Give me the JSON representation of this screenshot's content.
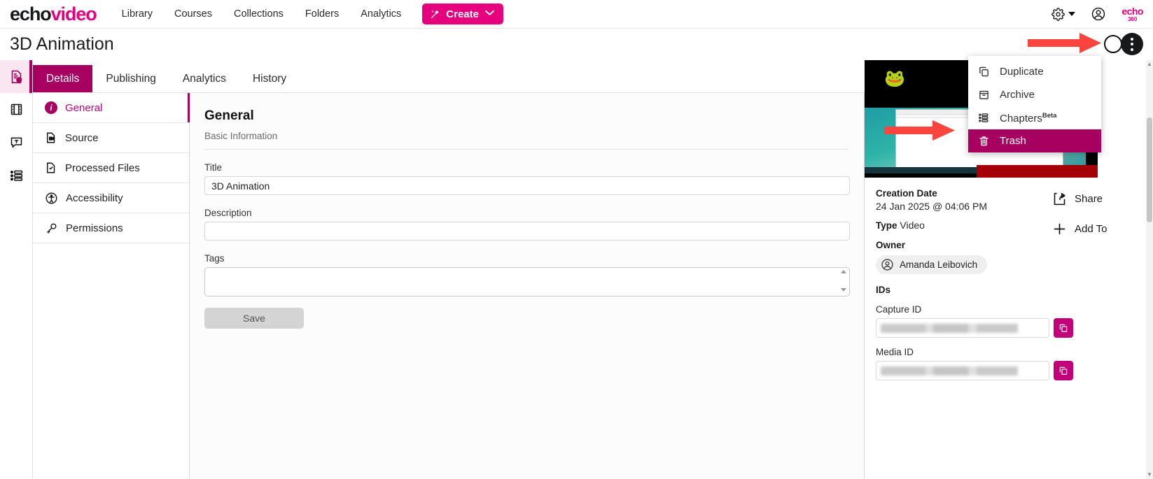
{
  "topnav": {
    "brand_part1": "echo",
    "brand_part2": "video",
    "links": [
      {
        "label": "Library"
      },
      {
        "label": "Courses"
      },
      {
        "label": "Collections"
      },
      {
        "label": "Folders"
      },
      {
        "label": "Analytics"
      }
    ],
    "create_label": "Create",
    "create_chevron": "⌄",
    "logo_line1": "echo",
    "logo_line2": "360"
  },
  "header": {
    "page_title": "3D Animation"
  },
  "rail": {
    "items": [
      {
        "name": "details-info",
        "active": true
      },
      {
        "name": "media-filmstrip",
        "active": false
      },
      {
        "name": "captions",
        "active": false
      },
      {
        "name": "list-settings",
        "active": false
      }
    ]
  },
  "tabs": [
    {
      "label": "Details",
      "active": true
    },
    {
      "label": "Publishing",
      "active": false
    },
    {
      "label": "Analytics",
      "active": false
    },
    {
      "label": "History",
      "active": false
    }
  ],
  "subnav": {
    "items": [
      {
        "label": "General",
        "active": true
      },
      {
        "label": "Source",
        "active": false
      },
      {
        "label": "Processed Files",
        "active": false
      },
      {
        "label": "Accessibility",
        "active": false
      },
      {
        "label": "Permissions",
        "active": false
      }
    ]
  },
  "form": {
    "section_title": "General",
    "section_subtitle": "Basic Information",
    "title_label": "Title",
    "title_value": "3D Animation",
    "description_label": "Description",
    "description_value": "",
    "description_placeholder": "",
    "tags_label": "Tags",
    "tags_value": "",
    "save_label": "Save"
  },
  "rightpanel": {
    "creation_date_label": "Creation Date",
    "creation_date_value": "24 Jan 2025 @ 04:06 PM",
    "type_label": "Type",
    "type_value": "Video",
    "owner_label": "Owner",
    "owner_name": "Amanda Leibovich",
    "ids_label": "IDs",
    "capture_id_label": "Capture ID",
    "capture_id_value": "",
    "media_id_label": "Media ID",
    "media_id_value": "",
    "share_label": "Share",
    "add_to_label": "Add To"
  },
  "menu": {
    "items": [
      {
        "label": "Duplicate",
        "icon": "duplicate-icon",
        "highlight": false,
        "sup": ""
      },
      {
        "label": "Archive",
        "icon": "archive-icon",
        "highlight": false,
        "sup": ""
      },
      {
        "label": "Chapters",
        "icon": "chapters-icon",
        "highlight": false,
        "sup": "Beta"
      },
      {
        "label": "Trash",
        "icon": "trash-icon",
        "highlight": true,
        "sup": ""
      }
    ]
  },
  "colors": {
    "brand_pink": "#e6007e",
    "accent_magenta": "#a80060",
    "annotation_red": "#f9453e"
  }
}
